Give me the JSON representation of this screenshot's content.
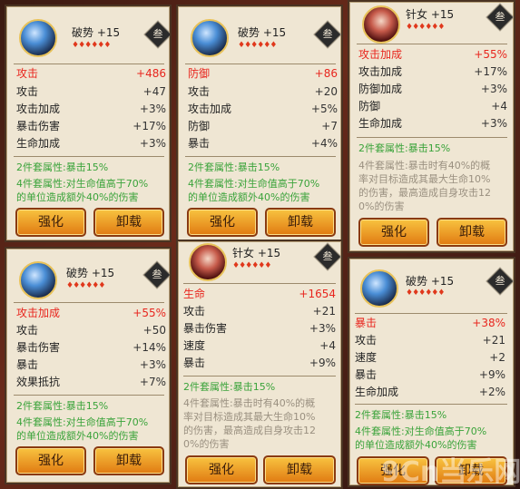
{
  "panels": [
    {
      "name": "破势",
      "level": "+15",
      "stars": "♦♦♦♦♦♦",
      "seal": "叁",
      "stats": [
        {
          "label": "攻击",
          "value": "+486"
        },
        {
          "label": "攻击",
          "value": "+47"
        },
        {
          "label": "攻击加成",
          "value": "+3%"
        },
        {
          "label": "暴击伤害",
          "value": "+17%"
        },
        {
          "label": "生命加成",
          "value": "+3%"
        }
      ],
      "set2": "2件套属性:暴击15%",
      "set4": "4件套属性:对生命值高于70%\n的单位造成额外40%的伤害",
      "strengthen": "强化",
      "unload": "卸载"
    },
    {
      "name": "破势",
      "level": "+15",
      "stars": "♦♦♦♦♦♦",
      "seal": "叁",
      "stats": [
        {
          "label": "防御",
          "value": "+86"
        },
        {
          "label": "攻击",
          "value": "+20"
        },
        {
          "label": "攻击加成",
          "value": "+5%"
        },
        {
          "label": "防御",
          "value": "+7"
        },
        {
          "label": "暴击",
          "value": "+4%"
        }
      ],
      "set2": "2件套属性:暴击15%",
      "set4": "4件套属性:对生命值高于70%\n的单位造成额外40%的伤害",
      "strengthen": "强化",
      "unload": "卸载"
    },
    {
      "name": "针女",
      "level": "+15",
      "stars": "♦♦♦♦♦♦",
      "seal": "叁",
      "stats": [
        {
          "label": "攻击加成",
          "value": "+55%"
        },
        {
          "label": "攻击加成",
          "value": "+17%"
        },
        {
          "label": "防御加成",
          "value": "+3%"
        },
        {
          "label": "防御",
          "value": "+4"
        },
        {
          "label": "生命加成",
          "value": "+3%"
        }
      ],
      "set2": "2件套属性:暴击15%",
      "set4": "4件套属性:暴击时有40%的概\n率对目标造成其最大生命10%\n的伤害，最高造成自身攻击12\n0%的伤害",
      "strengthen": "强化",
      "unload": "卸载"
    },
    {
      "name": "破势",
      "level": "+15",
      "stars": "♦♦♦♦♦♦",
      "seal": "叁",
      "stats": [
        {
          "label": "攻击加成",
          "value": "+55%"
        },
        {
          "label": "攻击",
          "value": "+50"
        },
        {
          "label": "暴击伤害",
          "value": "+14%"
        },
        {
          "label": "暴击",
          "value": "+3%"
        },
        {
          "label": "效果抵抗",
          "value": "+7%"
        }
      ],
      "set2": "2件套属性:暴击15%",
      "set4": "4件套属性:对生命值高于70%\n的单位造成额外40%的伤害",
      "strengthen": "强化",
      "unload": "卸载"
    },
    {
      "name": "针女",
      "level": "+15",
      "stars": "♦♦♦♦♦♦",
      "seal": "叁",
      "stats": [
        {
          "label": "生命",
          "value": "+1654"
        },
        {
          "label": "攻击",
          "value": "+21"
        },
        {
          "label": "暴击伤害",
          "value": "+3%"
        },
        {
          "label": "速度",
          "value": "+4"
        },
        {
          "label": "暴击",
          "value": "+9%"
        }
      ],
      "set2": "2件套属性:暴击15%",
      "set4": "4件套属性:暴击时有40%的概\n率对目标造成其最大生命10%\n的伤害，最高造成自身攻击12\n0%的伤害",
      "strengthen": "强化",
      "unload": "卸载"
    },
    {
      "name": "破势",
      "level": "+15",
      "stars": "♦♦♦♦♦♦",
      "seal": "叁",
      "stats": [
        {
          "label": "暴击",
          "value": "+38%"
        },
        {
          "label": "攻击",
          "value": "+21"
        },
        {
          "label": "速度",
          "value": "+2"
        },
        {
          "label": "暴击",
          "value": "+9%"
        },
        {
          "label": "生命加成",
          "value": "+2%"
        }
      ],
      "set2": "2件套属性:暴击15%",
      "set4": "4件套属性:对生命值高于70%\n的单位造成额外40%的伤害",
      "strengthen": "强化",
      "unload": "卸载"
    }
  ],
  "watermark": "9Cn当乐网",
  "colors": {
    "main_stat": "#e8261e",
    "set_active": "#3aa33a",
    "set_inactive": "#9a9080",
    "button": "#f0a028"
  }
}
